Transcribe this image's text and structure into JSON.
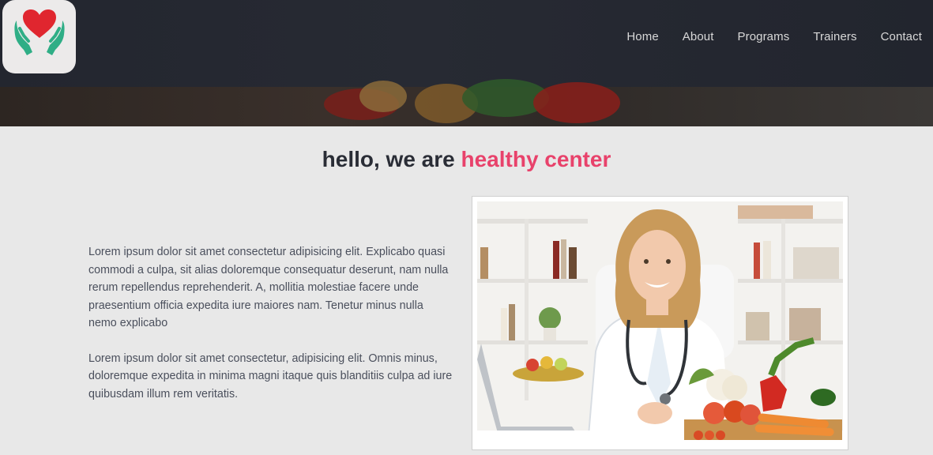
{
  "nav": {
    "items": [
      "Home",
      "About",
      "Programs",
      "Trainers",
      "Contact"
    ]
  },
  "heading": {
    "text": "hello, we are ",
    "accent": "healthy center"
  },
  "about": {
    "paragraph1": "Lorem ipsum dolor sit amet consectetur adipisicing elit. Explicabo quasi commodi a culpa, sit alias doloremque consequatur deserunt, nam nulla rerum repellendus reprehenderit. A, mollitia molestiae facere unde praesentium officia expedita iure maiores nam. Tenetur minus nulla nemo explicabo",
    "paragraph2": "Lorem ipsum dolor sit amet consectetur, adipisicing elit. Omnis minus, doloremque expedita in minima magni itaque quis blanditiis culpa ad iure quibusdam illum rem veritatis."
  },
  "colors": {
    "accent": "#e8426b",
    "header_bg": "#23262f",
    "page_bg": "#e8e8e8",
    "text": "#4a4f5c",
    "heading": "#2a2d36"
  },
  "icons": {
    "logo": "heart-in-hands-icon"
  }
}
